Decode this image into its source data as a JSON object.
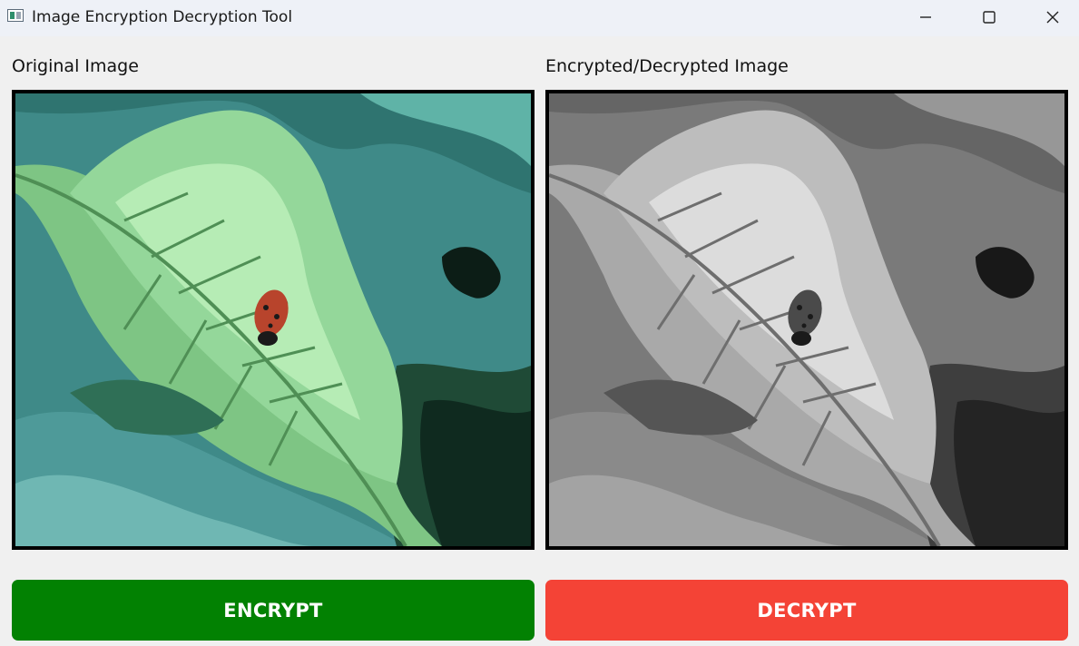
{
  "window": {
    "title": "Image Encryption Decryption Tool"
  },
  "panels": {
    "original_label": "Original Image",
    "result_label": "Encrypted/Decrypted Image"
  },
  "buttons": {
    "encrypt_label": "ENCRYPT",
    "decrypt_label": "DECRYPT"
  },
  "colors": {
    "encrypt": "#028102",
    "decrypt": "#f44336",
    "window_bg": "#f0f0f0",
    "titlebar_bg": "#eef1f7"
  },
  "icons": {
    "app": "image-window-icon",
    "minimize": "minimize-icon",
    "maximize": "maximize-icon",
    "close": "close-icon"
  }
}
